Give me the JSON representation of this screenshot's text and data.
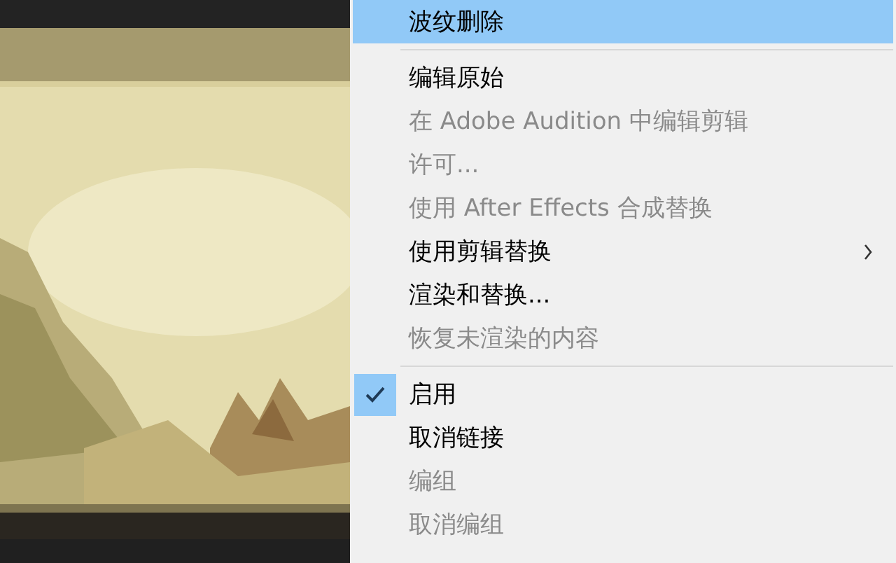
{
  "context_menu": {
    "groups": [
      {
        "items": [
          {
            "label": "波纹删除",
            "selected": true,
            "disabled": false,
            "checked": false,
            "has_submenu": false
          }
        ]
      },
      {
        "items": [
          {
            "label": "编辑原始",
            "selected": false,
            "disabled": false,
            "checked": false,
            "has_submenu": false
          },
          {
            "label": "在 Adobe Audition 中编辑剪辑",
            "selected": false,
            "disabled": true,
            "checked": false,
            "has_submenu": false
          },
          {
            "label": "许可...",
            "selected": false,
            "disabled": true,
            "checked": false,
            "has_submenu": false
          },
          {
            "label": "使用 After Effects 合成替换",
            "selected": false,
            "disabled": true,
            "checked": false,
            "has_submenu": false
          },
          {
            "label": "使用剪辑替换",
            "selected": false,
            "disabled": false,
            "checked": false,
            "has_submenu": true
          },
          {
            "label": "渲染和替换...",
            "selected": false,
            "disabled": false,
            "checked": false,
            "has_submenu": false
          },
          {
            "label": "恢复未渲染的内容",
            "selected": false,
            "disabled": true,
            "checked": false,
            "has_submenu": false
          }
        ]
      },
      {
        "items": [
          {
            "label": "启用",
            "selected": false,
            "disabled": false,
            "checked": true,
            "has_submenu": false
          },
          {
            "label": "取消链接",
            "selected": false,
            "disabled": false,
            "checked": false,
            "has_submenu": false
          },
          {
            "label": "编组",
            "selected": false,
            "disabled": true,
            "checked": false,
            "has_submenu": false
          },
          {
            "label": "取消编组",
            "selected": false,
            "disabled": true,
            "checked": false,
            "has_submenu": false
          }
        ]
      }
    ]
  }
}
